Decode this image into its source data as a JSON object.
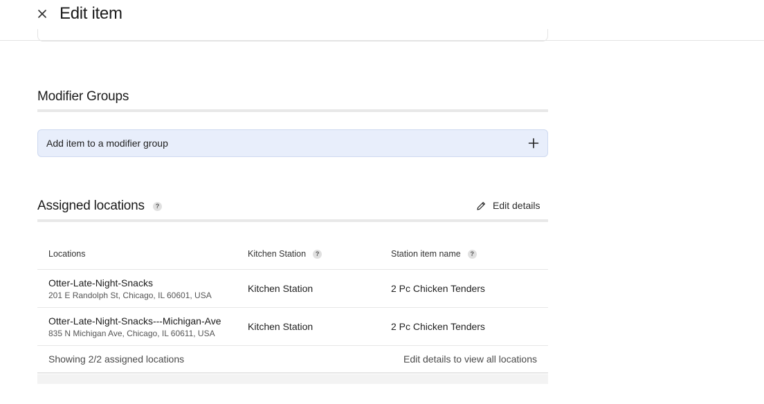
{
  "header": {
    "title": "Edit item",
    "close_icon": "close-icon"
  },
  "modifier_groups": {
    "title": "Modifier Groups",
    "add_label": "Add item to a modifier group",
    "add_icon": "plus-icon"
  },
  "assigned_locations": {
    "title": "Assigned locations",
    "help_glyph": "?",
    "edit_label": "Edit details",
    "edit_icon": "pencil-icon",
    "columns": [
      "Locations",
      "Kitchen Station",
      "Station item name"
    ],
    "rows": [
      {
        "name": "Otter-Late-Night-Snacks",
        "address": "201 E Randolph St, Chicago, IL 60601, USA",
        "station": "Kitchen Station",
        "item_name": "2 Pc Chicken Tenders"
      },
      {
        "name": "Otter-Late-Night-Snacks---Michigan-Ave",
        "address": "835 N Michigan Ave, Chicago, IL 60611, USA",
        "station": "Kitchen Station",
        "item_name": "2 Pc Chicken Tenders"
      }
    ],
    "footer_count": "Showing 2/2 assigned locations",
    "footer_link": "Edit details to view all locations"
  },
  "colors": {
    "accent_bg": "#e8eefb",
    "accent_border": "#cdd8ef"
  }
}
